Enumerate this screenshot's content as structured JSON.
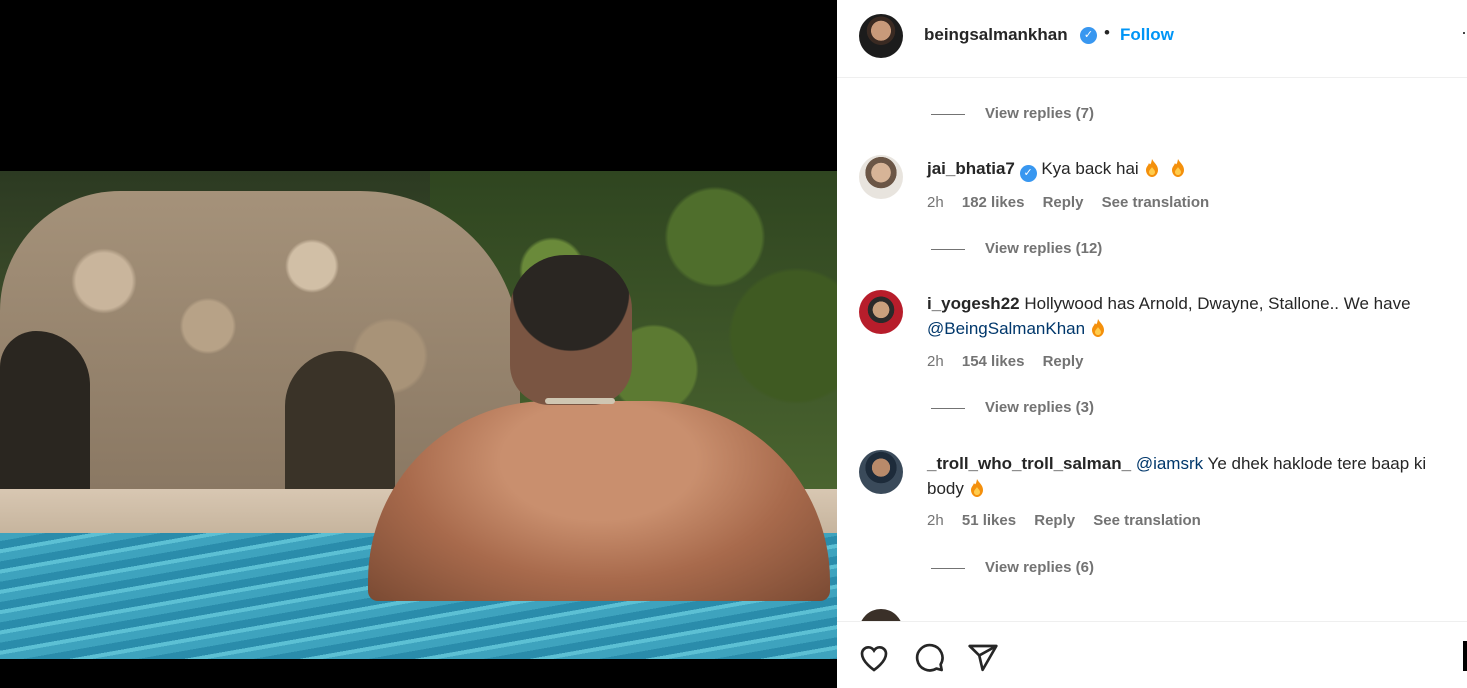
{
  "post": {
    "author": "beingsalmankhan",
    "follow_label": "Follow",
    "separator": "•",
    "more_label": "·"
  },
  "comments": [
    {
      "view_replies": "View replies (7)"
    },
    {
      "username": "jai_bhatia7",
      "verified": true,
      "text": "Kya back hai",
      "time": "2h",
      "likes": "182 likes",
      "reply": "Reply",
      "translation": "See translation",
      "view_replies": "View replies (12)"
    },
    {
      "username": "i_yogesh22",
      "verified": false,
      "text": "Hollywood has Arnold, Dwayne, Stallone.. We have",
      "mention": "@BeingSalmanKhan",
      "time": "2h",
      "likes": "154 likes",
      "reply": "Reply",
      "view_replies": "View replies (3)"
    },
    {
      "username": "_troll_who_troll_salman_",
      "verified": false,
      "mention": "@iamsrk",
      "text": "Ye dhek haklode tere baap ki body",
      "time": "2h",
      "likes": "51 likes",
      "reply": "Reply",
      "translation": "See translation",
      "view_replies": "View replies (6)"
    }
  ],
  "icons": {
    "like": "heart-icon",
    "comment": "comment-icon",
    "share": "share-icon",
    "verified": "verified-badge-icon",
    "fire": "fire-emoji-icon"
  },
  "colors": {
    "accent": "#0095f6",
    "verified": "#3897f0",
    "secondary_text": "#737373",
    "mention": "#00376b"
  }
}
